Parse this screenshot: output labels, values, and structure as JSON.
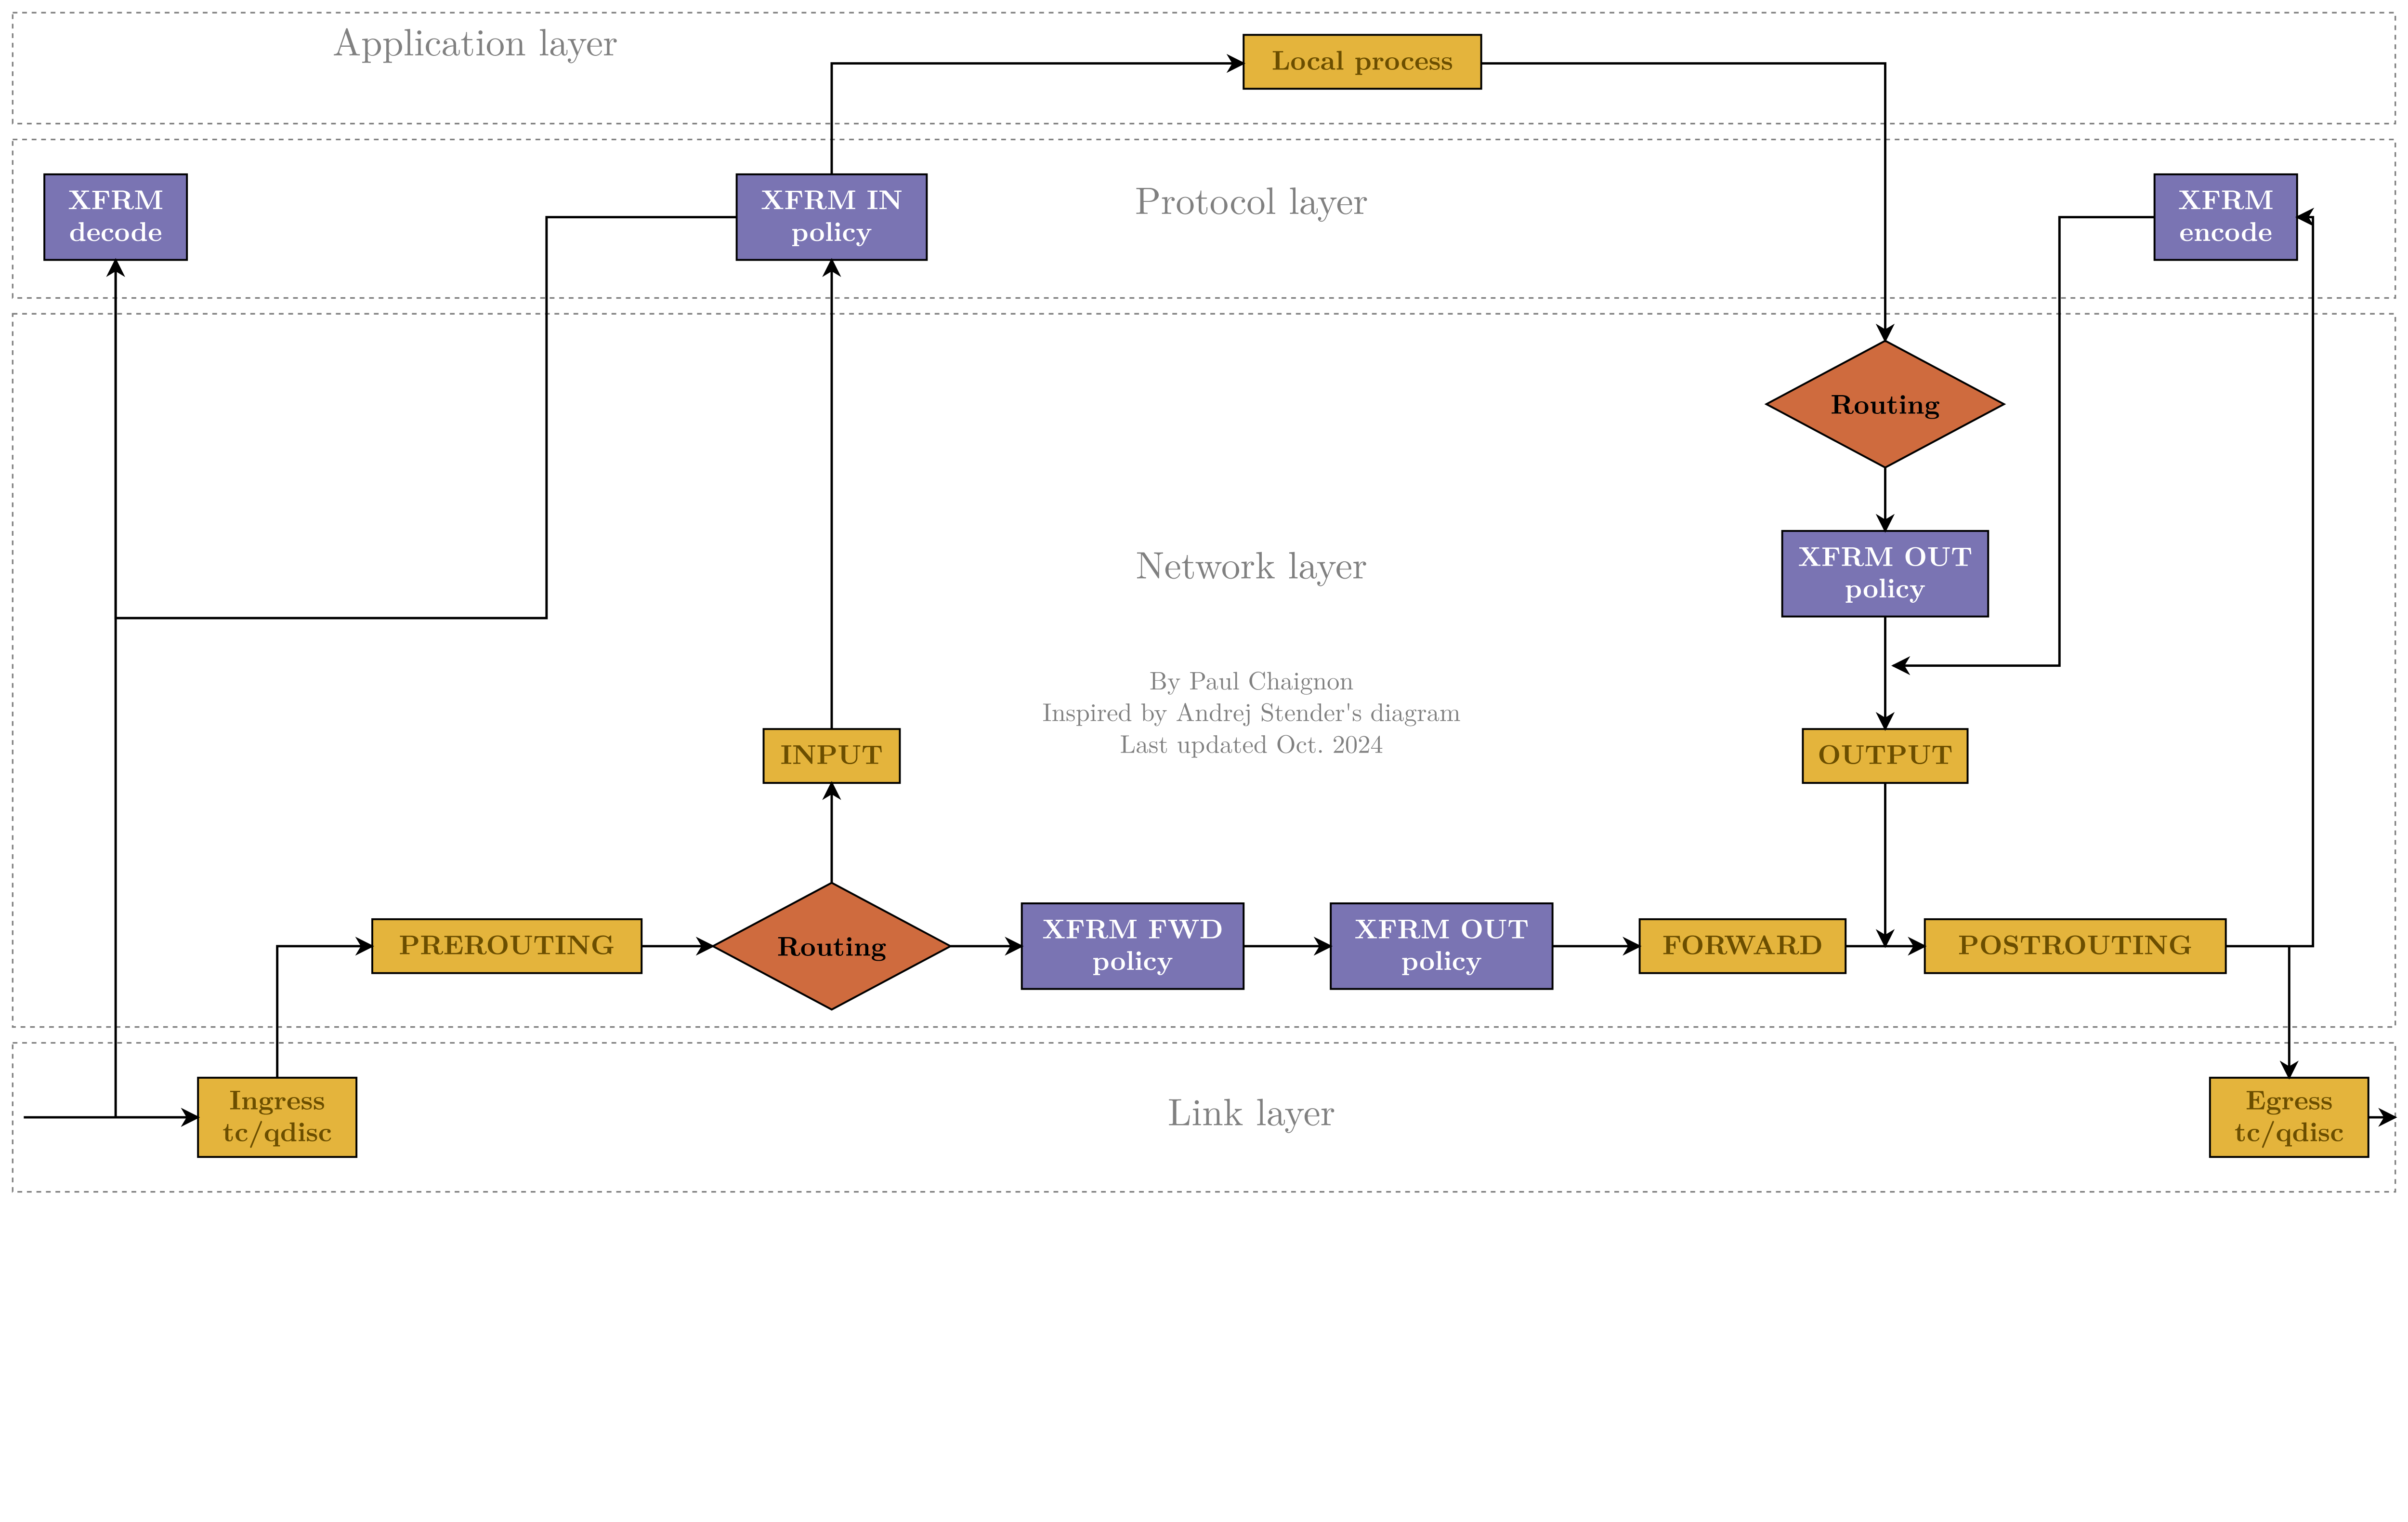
{
  "layers": {
    "application": "Application layer",
    "protocol": "Protocol layer",
    "network": "Network layer",
    "link": "Link layer"
  },
  "credit": {
    "line1": "By Paul Chaignon",
    "line2": "Inspired by Andrej Stender's diagram",
    "line3": "Last updated Oct. 2024"
  },
  "nodes": {
    "local_process": "Local process",
    "xfrm_decode1": "XFRM",
    "xfrm_decode2": "decode",
    "xfrm_in1": "XFRM IN",
    "xfrm_in2": "policy",
    "xfrm_encode1": "XFRM",
    "xfrm_encode2": "encode",
    "routing_top": "Routing",
    "xfrm_out_top1": "XFRM OUT",
    "xfrm_out_top2": "policy",
    "output": "OUTPUT",
    "input": "INPUT",
    "prerouting": "PREROUTING",
    "routing_bot": "Routing",
    "xfrm_fwd1": "XFRM FWD",
    "xfrm_fwd2": "policy",
    "xfrm_out_bot1": "XFRM OUT",
    "xfrm_out_bot2": "policy",
    "forward": "FORWARD",
    "postrouting": "POSTROUTING",
    "ingress1": "Ingress",
    "ingress2": "tc/qdisc",
    "egress1": "Egress",
    "egress2": "tc/qdisc"
  }
}
